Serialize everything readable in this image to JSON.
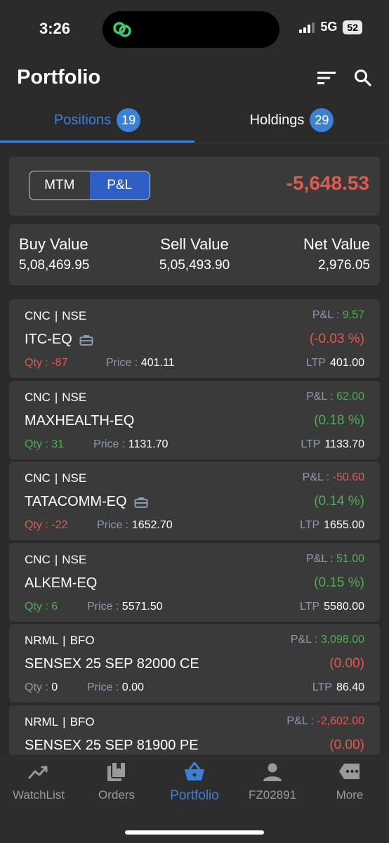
{
  "status_bar": {
    "time": "3:26",
    "network": "5G",
    "battery": "52"
  },
  "header": {
    "title": "Portfolio"
  },
  "tabs": [
    {
      "label": "Positions",
      "count": "19",
      "active": true
    },
    {
      "label": "Holdings",
      "count": "29",
      "active": false
    }
  ],
  "mtm_toggle": {
    "options": [
      "MTM",
      "P&L"
    ],
    "selected": "P&L"
  },
  "total_pnl": "-5,648.53",
  "summary": {
    "buy_label": "Buy Value",
    "buy_value": "5,08,469.95",
    "sell_label": "Sell Value",
    "sell_value": "5,05,493.90",
    "net_label": "Net Value",
    "net_value": "2,976.05"
  },
  "labels": {
    "qty": "Qty : ",
    "price": "Price : ",
    "ltp": "LTP",
    "pnl": "P&L : ",
    "sep": "|"
  },
  "positions": [
    {
      "product": "CNC",
      "exchange": "NSE",
      "symbol": "ITC-EQ",
      "briefcase": true,
      "qty": "-87",
      "price": "401.11",
      "pnl": "9.57",
      "pct": "(-0.03 %)",
      "ltp": "401.00"
    },
    {
      "product": "CNC",
      "exchange": "NSE",
      "symbol": "MAXHEALTH-EQ",
      "briefcase": false,
      "qty": "31",
      "price": "1131.70",
      "pnl": "62.00",
      "pct": "(0.18 %)",
      "ltp": "1133.70"
    },
    {
      "product": "CNC",
      "exchange": "NSE",
      "symbol": "TATACOMM-EQ",
      "briefcase": true,
      "qty": "-22",
      "price": "1652.70",
      "pnl": "-50.60",
      "pct": "(0.14 %)",
      "ltp": "1655.00"
    },
    {
      "product": "CNC",
      "exchange": "NSE",
      "symbol": "ALKEM-EQ",
      "briefcase": false,
      "qty": "6",
      "price": "5571.50",
      "pnl": "51.00",
      "pct": "(0.15 %)",
      "ltp": "5580.00"
    },
    {
      "product": "NRML",
      "exchange": "BFO",
      "symbol": "SENSEX 25 SEP 82000 CE",
      "briefcase": false,
      "qty": "0",
      "price": "0.00",
      "pnl": "3,098.00",
      "pct": "(0.00)",
      "ltp": "86.40"
    },
    {
      "product": "NRML",
      "exchange": "BFO",
      "symbol": "SENSEX 25 SEP 81900 PE",
      "briefcase": false,
      "qty": "",
      "price": "",
      "pnl": "-2,602.00",
      "pct": "(0.00)",
      "ltp": ""
    }
  ],
  "bottom_nav": [
    {
      "label": "WatchList",
      "icon": "trend-chart-icon"
    },
    {
      "label": "Orders",
      "icon": "orders-book-icon"
    },
    {
      "label": "Portfolio",
      "icon": "basket-icon",
      "active": true
    },
    {
      "label": "FZ02891",
      "icon": "user-icon"
    },
    {
      "label": "More",
      "icon": "more-dots-icon"
    }
  ],
  "colors": {
    "accent": "#3b82d6",
    "profit": "#4caf50",
    "loss": "#e35a4d",
    "card": "#3a3a3a",
    "background": "#2a2a2a"
  }
}
